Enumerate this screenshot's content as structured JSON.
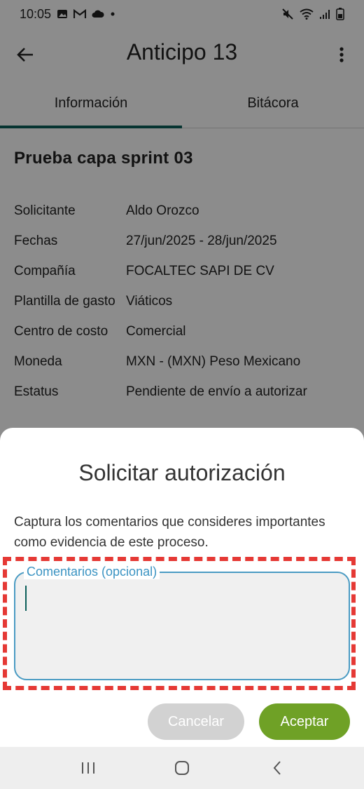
{
  "status_bar": {
    "time": "10:05",
    "icons": [
      "gallery-icon",
      "gmail-icon",
      "cloud-icon",
      "dot-icon",
      "mute-icon",
      "wifi-icon",
      "signal-icon",
      "battery-icon"
    ]
  },
  "app_bar": {
    "title": "Anticipo 13",
    "back_icon": "arrow-left-icon",
    "more_icon": "more-vert-icon"
  },
  "tabs": [
    {
      "label": "Información",
      "active": true
    },
    {
      "label": "Bitácora",
      "active": false
    }
  ],
  "detail": {
    "heading": "Prueba capa sprint 03",
    "rows": [
      {
        "key": "Solicitante",
        "value": "Aldo Orozco"
      },
      {
        "key": "Fechas",
        "value": "27/jun/2025 - 28/jun/2025"
      },
      {
        "key": "Compañía",
        "value": "FOCALTEC SAPI DE CV"
      },
      {
        "key": "Plantilla de gasto",
        "value": "Viáticos"
      },
      {
        "key": "Centro de costo",
        "value": "Comercial"
      },
      {
        "key": "Moneda",
        "value": "MXN - (MXN) Peso Mexicano"
      },
      {
        "key": "Estatus",
        "value": "Pendiente de envío a autorizar"
      }
    ]
  },
  "dialog": {
    "title": "Solicitar autorización",
    "description": "Captura los comentarios que consideres importantes como evidencia de este proceso.",
    "comment_field": {
      "label": "Comentarios (opcional)",
      "value": ""
    },
    "cancel_label": "Cancelar",
    "accept_label": "Aceptar"
  },
  "colors": {
    "accent": "#0b5f5a",
    "field_border": "#4a9bc3",
    "accept": "#6fa126",
    "cancel": "#d2d2d2",
    "highlight": "#e53935"
  },
  "nav_bar": {
    "icons": [
      "recents-icon",
      "home-icon",
      "back-icon"
    ]
  }
}
